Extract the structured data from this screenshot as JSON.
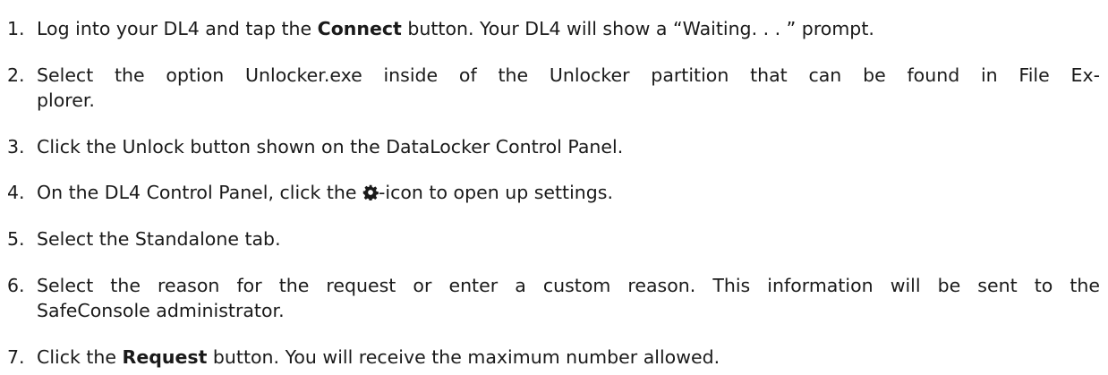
{
  "steps": [
    {
      "number": "1.",
      "parts": [
        "Log into your DL4 and tap the ",
        "Connect",
        " button. Your DL4 will show a “Waiting. . . ” prompt."
      ]
    },
    {
      "number": "2.",
      "line1": "Select the option Unlocker.exe inside of the Unlocker partition that can be found in File Ex-",
      "line2": "plorer."
    },
    {
      "number": "3.",
      "text": "Click the Unlock button shown on the DataLocker Control Panel."
    },
    {
      "number": "4.",
      "before_icon": "On the DL4 Control Panel, click the ",
      "icon": "gear-icon",
      "after_icon": "-icon to open up settings."
    },
    {
      "number": "5.",
      "text": "Select the Standalone tab."
    },
    {
      "number": "6.",
      "line1": "Select the reason for the request or enter a custom reason. This information will be sent to the",
      "line2": "SafeConsole administrator."
    },
    {
      "number": "7.",
      "parts": [
        "Click the ",
        "Request",
        " button. You will receive the maximum number allowed."
      ]
    }
  ]
}
